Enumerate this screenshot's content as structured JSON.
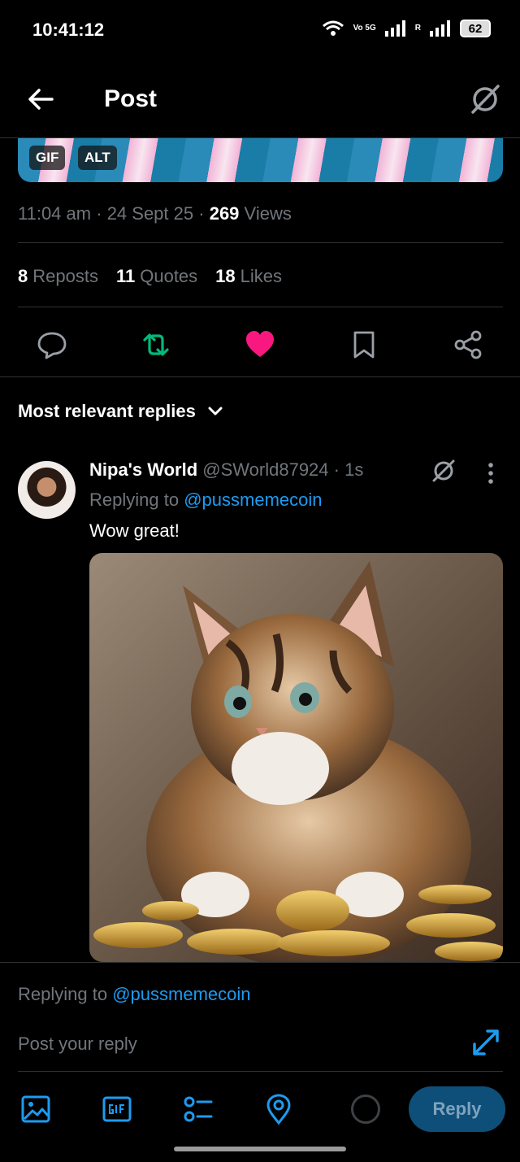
{
  "status_bar": {
    "time": "10:41:12",
    "network_label": "Vo 5G",
    "roaming_label": "R",
    "battery": "62"
  },
  "header": {
    "title": "Post"
  },
  "media": {
    "gif_badge": "GIF",
    "alt_badge": "ALT"
  },
  "post_meta": {
    "time": "11:04 am",
    "date": "24 Sept 25",
    "views_count": "269",
    "views_label": "Views"
  },
  "stats": {
    "reposts_count": "8",
    "reposts_label": "Reposts",
    "quotes_count": "11",
    "quotes_label": "Quotes",
    "likes_count": "18",
    "likes_label": "Likes"
  },
  "actions": {
    "liked": true,
    "reposted": true,
    "colors": {
      "repost": "#00ba7c",
      "like": "#f91880",
      "icon": "#71767b",
      "link": "#1d9bf0"
    }
  },
  "sort": {
    "label": "Most relevant replies"
  },
  "reply": {
    "author_name": "Nipa's World",
    "author_handle": "@SWorld87924",
    "time_ago": "1s",
    "replying_to_label": "Replying to",
    "replying_to_handle": "@pussmemecoin",
    "text": "Wow great!"
  },
  "composer": {
    "replying_to_label": "Replying to",
    "replying_to_handle": "@pussmemecoin",
    "placeholder": "Post your reply",
    "reply_button": "Reply",
    "tools": [
      "image-icon",
      "gif-icon",
      "poll-icon",
      "location-icon"
    ]
  }
}
